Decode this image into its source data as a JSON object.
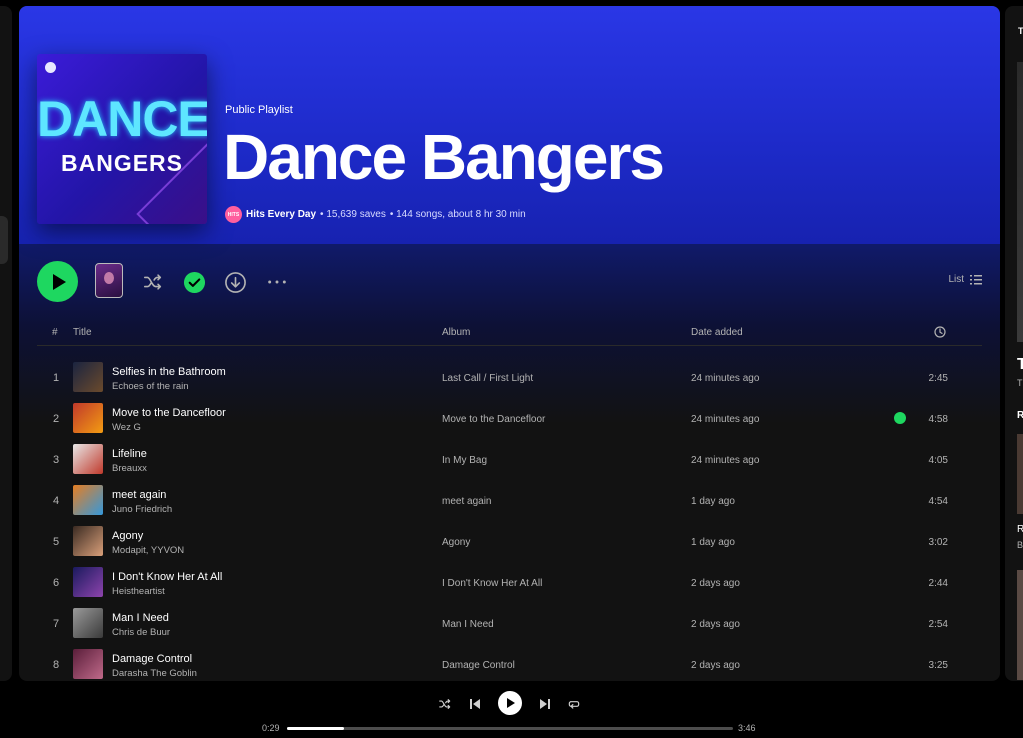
{
  "playlist": {
    "type_label": "Public Playlist",
    "title": "Dance Bangers",
    "cover_line1": "DANCE",
    "cover_line2": "BANGERS",
    "owner_badge": "HITS",
    "owner": "Hits Every Day",
    "saves": "• 15,639 saves",
    "songs_info": "• 144 songs, about 8 hr 30 min"
  },
  "actions": {
    "view_label": "List"
  },
  "table_headers": {
    "num": "#",
    "title": "Title",
    "album": "Album",
    "date_added": "Date added"
  },
  "tracks": [
    {
      "num": "1",
      "title": "Selfies in the Bathroom",
      "artist": "Echoes of the rain",
      "album": "Last Call / First Light",
      "date_added": "24 minutes ago",
      "duration": "2:45",
      "saved": false,
      "art_colors": [
        "#1b2440",
        "#6b4a2c"
      ]
    },
    {
      "num": "2",
      "title": "Move to the Dancefloor",
      "artist": "Wez G",
      "album": "Move to the Dancefloor",
      "date_added": "24 minutes ago",
      "duration": "4:58",
      "saved": true,
      "art_colors": [
        "#c0392b",
        "#f39c12"
      ]
    },
    {
      "num": "3",
      "title": "Lifeline",
      "artist": "Breauxx",
      "album": "In My Bag",
      "date_added": "24 minutes ago",
      "duration": "4:05",
      "saved": false,
      "art_colors": [
        "#e8e8e8",
        "#c0392b"
      ]
    },
    {
      "num": "4",
      "title": "meet again",
      "artist": "Juno Friedrich",
      "album": "meet again",
      "date_added": "1 day ago",
      "duration": "4:54",
      "saved": false,
      "art_colors": [
        "#e67e22",
        "#3498db"
      ]
    },
    {
      "num": "5",
      "title": "Agony",
      "artist": "Modapit, YYVON",
      "album": "Agony",
      "date_added": "1 day ago",
      "duration": "3:02",
      "saved": false,
      "art_colors": [
        "#3a2a22",
        "#d9a07a"
      ]
    },
    {
      "num": "6",
      "title": "I Don't Know Her At All",
      "artist": "Heistheartist",
      "album": "I Don't Know Her At All",
      "date_added": "2 days ago",
      "duration": "2:44",
      "saved": false,
      "art_colors": [
        "#1a1a5e",
        "#8e44ad"
      ]
    },
    {
      "num": "7",
      "title": "Man I Need",
      "artist": "Chris de Buur",
      "album": "Man I Need",
      "date_added": "2 days ago",
      "duration": "2:54",
      "saved": false,
      "art_colors": [
        "#9a9a9a",
        "#3a3a3a"
      ]
    },
    {
      "num": "8",
      "title": "Damage Control",
      "artist": "Darasha The Goblin",
      "album": "Damage Control",
      "date_added": "2 days ago",
      "duration": "3:25",
      "saved": false,
      "art_colors": [
        "#5a1e3a",
        "#c06a8a"
      ]
    }
  ],
  "right_panel": {
    "t1": "T",
    "t2": "T",
    "t3": "T",
    "t4": "R",
    "t5": "R",
    "t6": "B"
  },
  "player": {
    "elapsed": "0:29",
    "total": "3:46",
    "progress": 0.128
  },
  "colors": {
    "accent": "#1ed760",
    "hero": "#2a37e6",
    "background": "#121212"
  }
}
